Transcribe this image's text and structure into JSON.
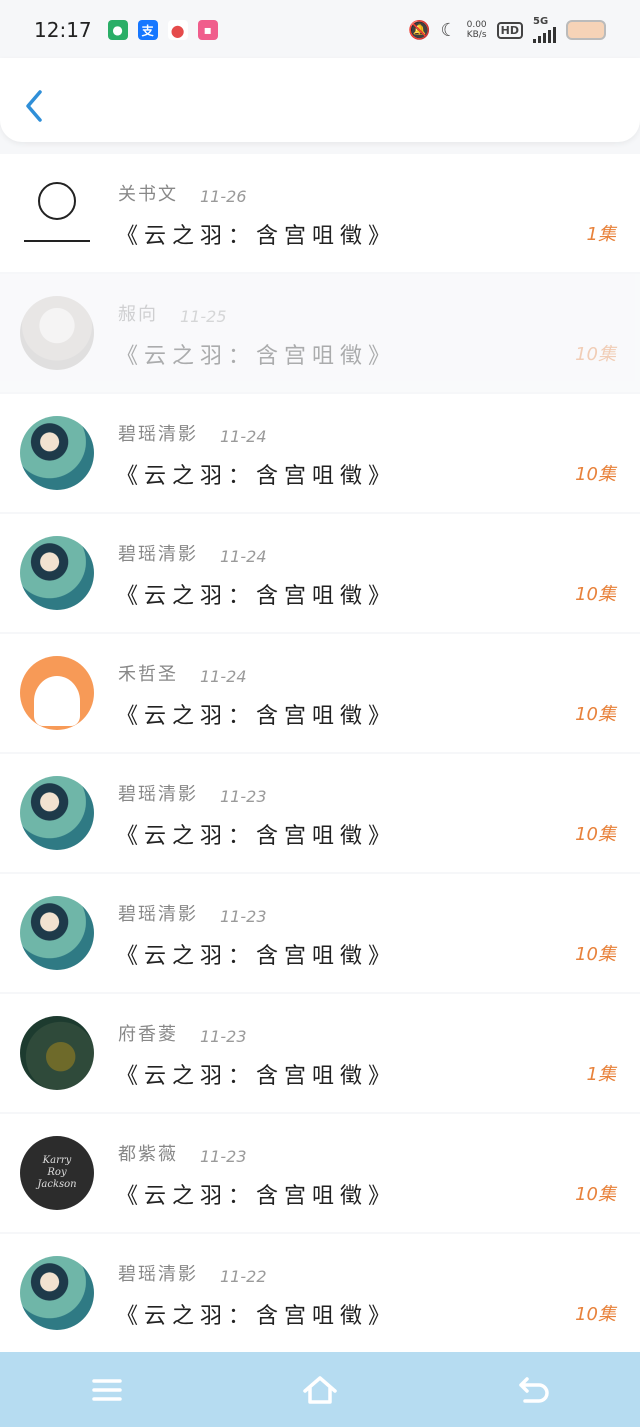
{
  "status_bar": {
    "time": "12:17",
    "apps": [
      {
        "name": "wechat-icon",
        "color": "#2aae67",
        "glyph": "●"
      },
      {
        "name": "alipay-icon",
        "color": "#1677ff",
        "glyph": "支"
      },
      {
        "name": "maps-icon",
        "color": "#e54b4b",
        "glyph": "●"
      },
      {
        "name": "app-icon",
        "color": "#f05d8c",
        "glyph": "▪"
      }
    ],
    "speed_top": "0.00",
    "speed_bottom": "KB/s",
    "hd": "HD",
    "network": "5G"
  },
  "header": {
    "back_icon": "chevron-left-icon"
  },
  "rows": [
    {
      "name": "关书文",
      "date": "11-26",
      "title": "《云之羽：含宫咀徵》",
      "count": "1集",
      "avatar": "meme",
      "faded": false
    },
    {
      "name": "赧向",
      "date": "11-25",
      "title": "《云之羽：含宫咀徵》",
      "count": "10集",
      "avatar": "white",
      "faded": true
    },
    {
      "name": "碧瑶清影",
      "date": "11-24",
      "title": "《云之羽：含宫咀徵》",
      "count": "10集",
      "avatar": "anime",
      "faded": false
    },
    {
      "name": "碧瑶清影",
      "date": "11-24",
      "title": "《云之羽：含宫咀徵》",
      "count": "10集",
      "avatar": "anime",
      "faded": false
    },
    {
      "name": "禾哲圣",
      "date": "11-24",
      "title": "《云之羽：含宫咀徵》",
      "count": "10集",
      "avatar": "bunny",
      "faded": false
    },
    {
      "name": "碧瑶清影",
      "date": "11-23",
      "title": "《云之羽：含宫咀徵》",
      "count": "10集",
      "avatar": "anime",
      "faded": false
    },
    {
      "name": "碧瑶清影",
      "date": "11-23",
      "title": "《云之羽：含宫咀徵》",
      "count": "10集",
      "avatar": "anime",
      "faded": false
    },
    {
      "name": "府香菱",
      "date": "11-23",
      "title": "《云之羽：含宫咀徵》",
      "count": "1集",
      "avatar": "bull",
      "faded": false
    },
    {
      "name": "都紫薇",
      "date": "11-23",
      "title": "《云之羽：含宫咀徵》",
      "count": "10集",
      "avatar": "dark",
      "faded": false
    },
    {
      "name": "碧瑶清影",
      "date": "11-22",
      "title": "《云之羽：含宫咀徵》",
      "count": "10集",
      "avatar": "anime",
      "faded": false
    }
  ],
  "avatar_dark_text": [
    "Karry",
    "Roy",
    "Jackson"
  ],
  "navbar": {
    "items": [
      "menu-icon",
      "home-icon",
      "back-icon"
    ]
  },
  "colors": {
    "accent": "#2f8fd8",
    "count": "#e8823b",
    "navbar": "#b6dcf1"
  }
}
